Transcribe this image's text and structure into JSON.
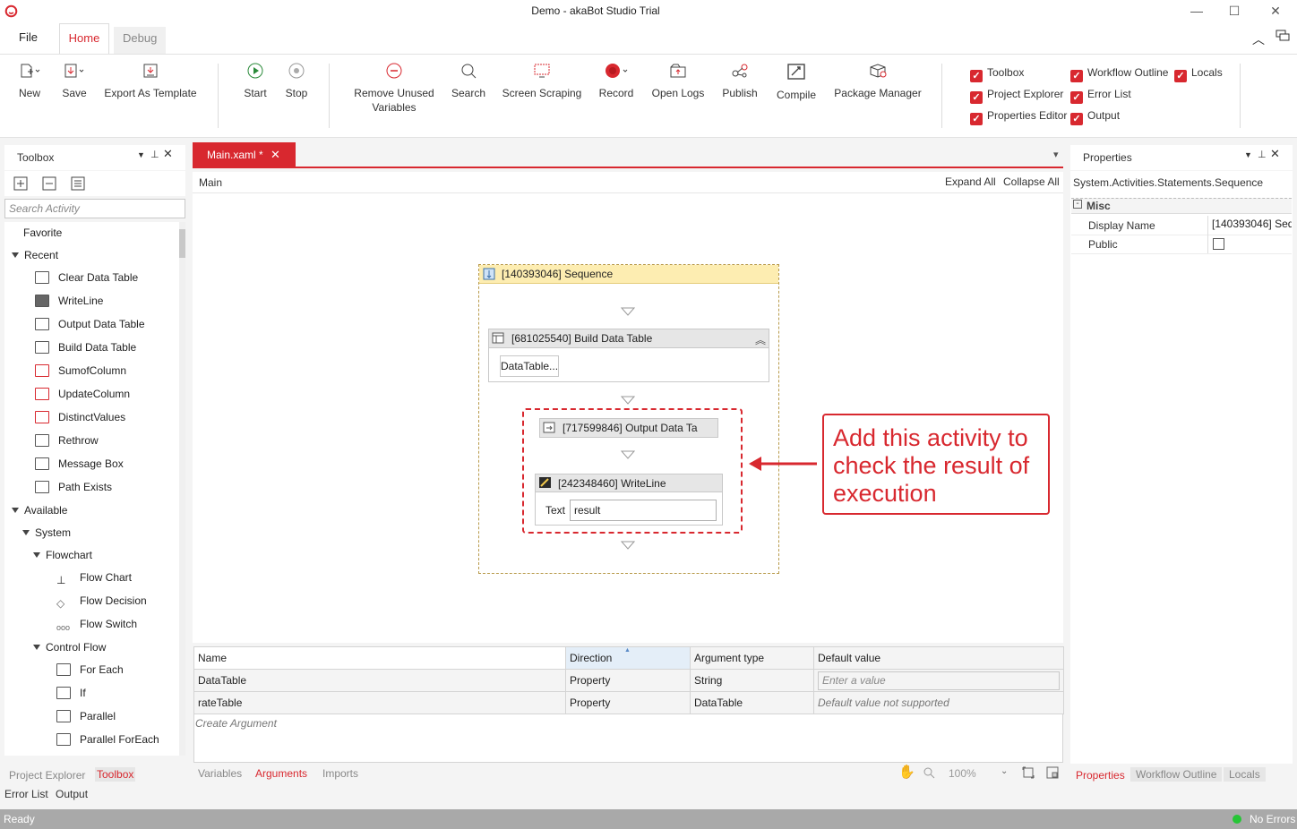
{
  "window": {
    "title": "Demo - akaBot Studio Trial"
  },
  "menu_tabs": [
    {
      "label": "File"
    },
    {
      "label": "Home"
    },
    {
      "label": "Debug"
    }
  ],
  "ribbon": {
    "buttons": [
      {
        "label": "New"
      },
      {
        "label": "Save"
      },
      {
        "label": "Export As Template"
      },
      {
        "label": "Start"
      },
      {
        "label": "Stop"
      },
      {
        "label": "Remove Unused Variables"
      },
      {
        "label": "Search"
      },
      {
        "label": "Screen Scraping"
      },
      {
        "label": "Record"
      },
      {
        "label": "Open Logs"
      },
      {
        "label": "Publish"
      },
      {
        "label": "Compile"
      },
      {
        "label": "Package Manager"
      }
    ],
    "checkboxes": [
      {
        "label": "Toolbox",
        "checked": true
      },
      {
        "label": "Project Explorer",
        "checked": true
      },
      {
        "label": "Properties Editor",
        "checked": true
      },
      {
        "label": "Workflow Outline",
        "checked": true
      },
      {
        "label": "Error List",
        "checked": true
      },
      {
        "label": "Output",
        "checked": true
      },
      {
        "label": "Locals",
        "checked": true
      }
    ]
  },
  "toolbox": {
    "title": "Toolbox",
    "search_placeholder": "Search Activity",
    "favorite": "Favorite",
    "recent_label": "Recent",
    "recent": [
      "Clear Data Table",
      "WriteLine",
      "Output Data Table",
      "Build Data Table",
      "SumofColumn",
      "UpdateColumn",
      "DistinctValues",
      "Rethrow",
      "Message Box",
      "Path Exists"
    ],
    "available_label": "Available",
    "system_label": "System",
    "flowchart_label": "Flowchart",
    "flowchart": [
      "Flow Chart",
      "Flow Decision",
      "Flow Switch"
    ],
    "control_flow_label": "Control Flow",
    "control_flow": [
      "For Each",
      "If",
      "Parallel",
      "Parallel ForEach"
    ],
    "bottom_tabs": [
      "Project Explorer",
      "Toolbox"
    ],
    "bottom_tabs2": [
      "Error List",
      "Output"
    ]
  },
  "designer": {
    "doc_tab": "Main.xaml *",
    "breadcrumb": "Main",
    "expand_all": "Expand All",
    "collapse_all": "Collapse All",
    "sequence_title": "[140393046] Sequence",
    "build_title": "[681025540] Build Data Table",
    "build_button": "DataTable...",
    "output_title": "[717599846] Output Data Ta",
    "writeline_title": "[242348460] WriteLine",
    "writeline_text_label": "Text",
    "writeline_text_value": "result",
    "callout": "Add this activity to check the result of execution"
  },
  "arguments": {
    "columns": [
      "Name",
      "Direction",
      "Argument type",
      "Default value"
    ],
    "rows": [
      {
        "name": "DataTable",
        "direction": "Property",
        "type": "String",
        "default": "Enter a value"
      },
      {
        "name": "rateTable",
        "direction": "Property",
        "type": "DataTable",
        "default": "Default value not supported"
      }
    ],
    "create": "Create Argument",
    "bottom_tabs": [
      "Variables",
      "Arguments",
      "Imports"
    ],
    "zoom": "100%"
  },
  "properties": {
    "title": "Properties",
    "type": "System.Activities.Statements.Sequence",
    "category": "Misc",
    "rows": [
      {
        "label": "Display Name",
        "value": "[140393046] Seq"
      },
      {
        "label": "Public",
        "value": ""
      }
    ],
    "bottom_tabs": [
      "Properties",
      "Workflow Outline",
      "Locals"
    ]
  },
  "status": {
    "left": "Ready",
    "right": "No Errors"
  },
  "colors": {
    "accent": "#d8282f",
    "status_bar": "#a9a9a9",
    "sequence_header": "#fdedb1"
  }
}
